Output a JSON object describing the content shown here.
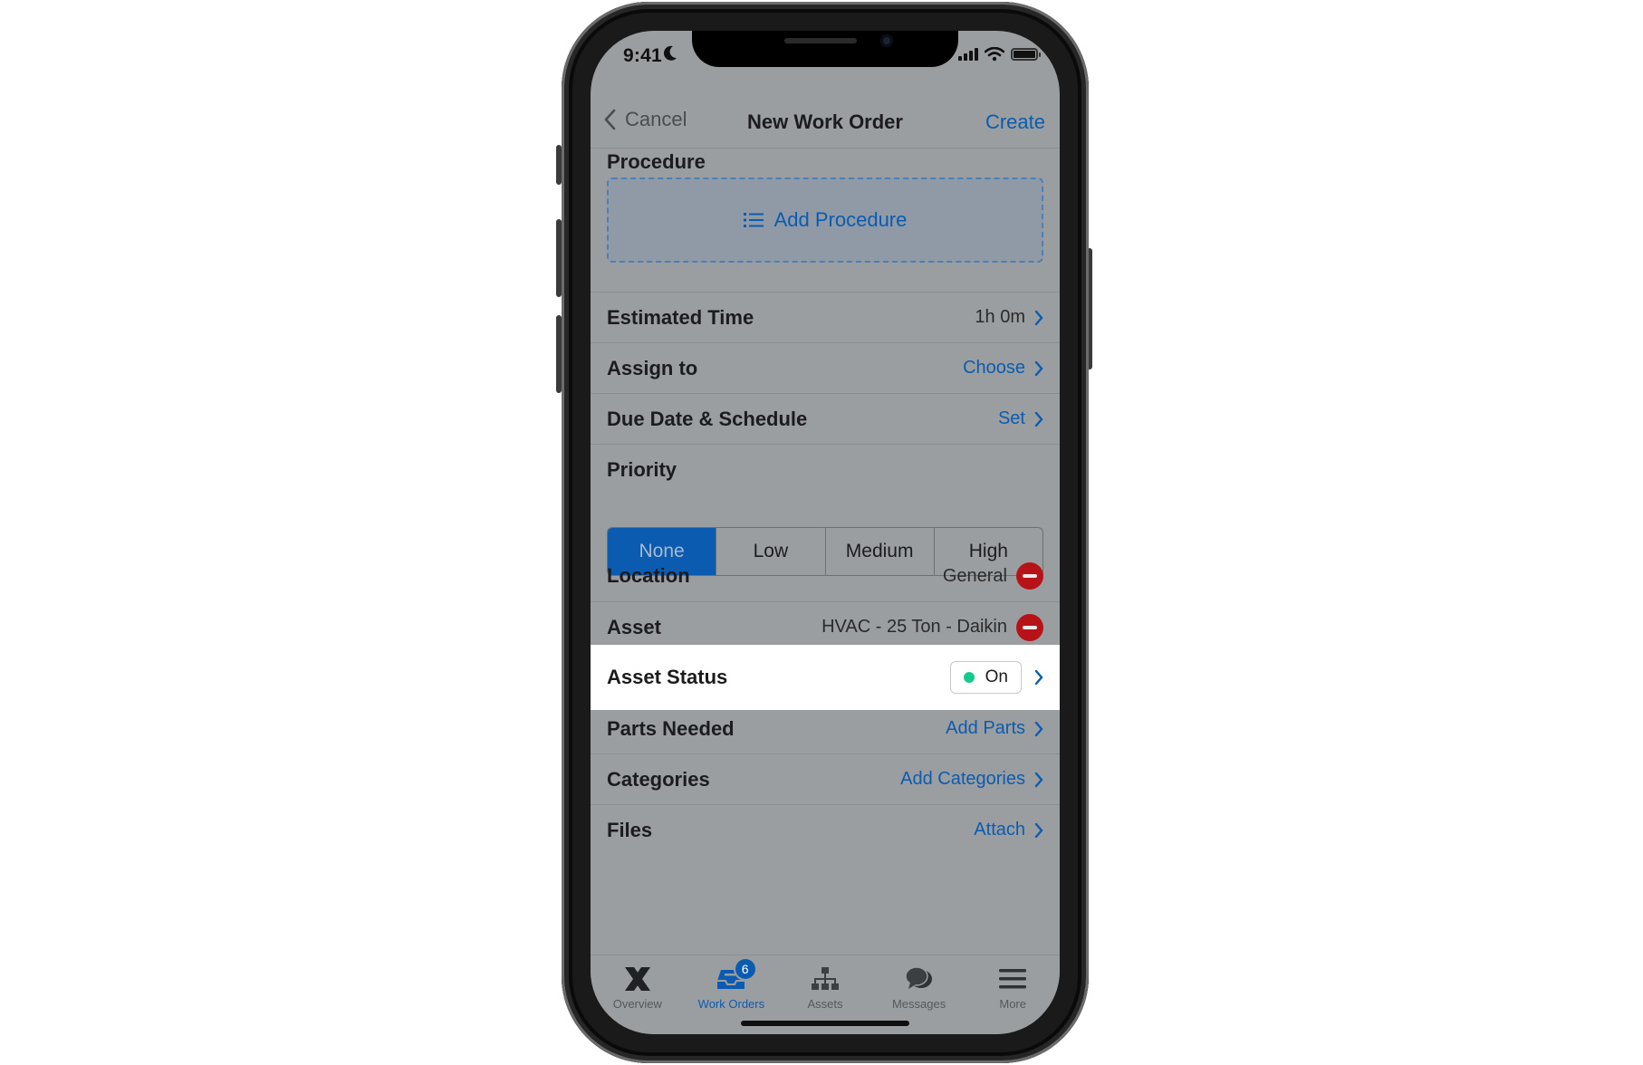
{
  "status_bar": {
    "time": "9:41"
  },
  "nav": {
    "back_label": "Cancel",
    "title": "New Work Order",
    "create_label": "Create"
  },
  "procedure": {
    "title": "Procedure",
    "add_label": "Add Procedure"
  },
  "rows": {
    "estimated_time": {
      "label": "Estimated Time",
      "value": "1h 0m"
    },
    "assign_to": {
      "label": "Assign to",
      "value": "Choose"
    },
    "due_date": {
      "label": "Due Date & Schedule",
      "value": "Set"
    }
  },
  "priority": {
    "title": "Priority",
    "options": [
      "None",
      "Low",
      "Medium",
      "High"
    ],
    "selected": "None"
  },
  "location": {
    "label": "Location",
    "value": "General"
  },
  "asset": {
    "label": "Asset",
    "value": "HVAC - 25 Ton - Daikin"
  },
  "asset_status": {
    "label": "Asset Status",
    "value": "On",
    "color": "#16c98d"
  },
  "parts": {
    "label": "Parts Needed",
    "value": "Add Parts"
  },
  "categories": {
    "label": "Categories",
    "value": "Add Categories"
  },
  "files": {
    "label": "Files",
    "value": "Attach"
  },
  "tabbar": {
    "tabs": [
      {
        "label": "Overview",
        "icon": "x-logo-icon"
      },
      {
        "label": "Work Orders",
        "icon": "inbox-icon",
        "badge": "6"
      },
      {
        "label": "Assets",
        "icon": "hierarchy-icon"
      },
      {
        "label": "Messages",
        "icon": "chat-bubbles-icon"
      },
      {
        "label": "More",
        "icon": "menu-icon"
      }
    ]
  },
  "colors": {
    "accent": "#0b5cb0",
    "destructive": "#b81219",
    "status_on": "#16c98d",
    "dimmed_bg": "#9b9ea1"
  }
}
